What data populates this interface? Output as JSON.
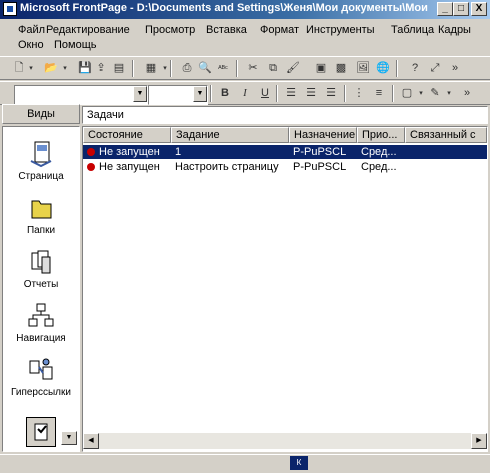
{
  "window": {
    "title": "Microsoft FrontPage - D:\\Documents and Settings\\Женя\\Мои документы\\Мои ...",
    "minimize": "_",
    "maximize": "□",
    "close": "X"
  },
  "menu": {
    "row1": [
      "Файл",
      "Редактирование",
      "Просмотр",
      "Вставка",
      "Формат",
      "Инструменты",
      "Таблица",
      "Кадры"
    ],
    "row2": [
      "Окно",
      "Помощь"
    ]
  },
  "formatting": {
    "bold": "B",
    "italic": "I",
    "underline": "U"
  },
  "views": {
    "header": "Виды",
    "items": [
      "Страница",
      "Папки",
      "Отчеты",
      "Навигация",
      "Гиперссылки"
    ]
  },
  "tasks": {
    "label": "Задачи",
    "columns": [
      "Состояние",
      "Задание",
      "Назначение",
      "Прио...",
      "Связанный с"
    ],
    "rows": [
      {
        "status": "Не запущен",
        "task": "1",
        "assigned": "P-PuPSCL",
        "priority": "Сред...",
        "linked": ""
      },
      {
        "status": "Не запущен",
        "task": "Настроить страницу",
        "assigned": "P-PuPSCL",
        "priority": "Сред...",
        "linked": ""
      }
    ]
  },
  "statusbar": {
    "indicator": "К"
  }
}
